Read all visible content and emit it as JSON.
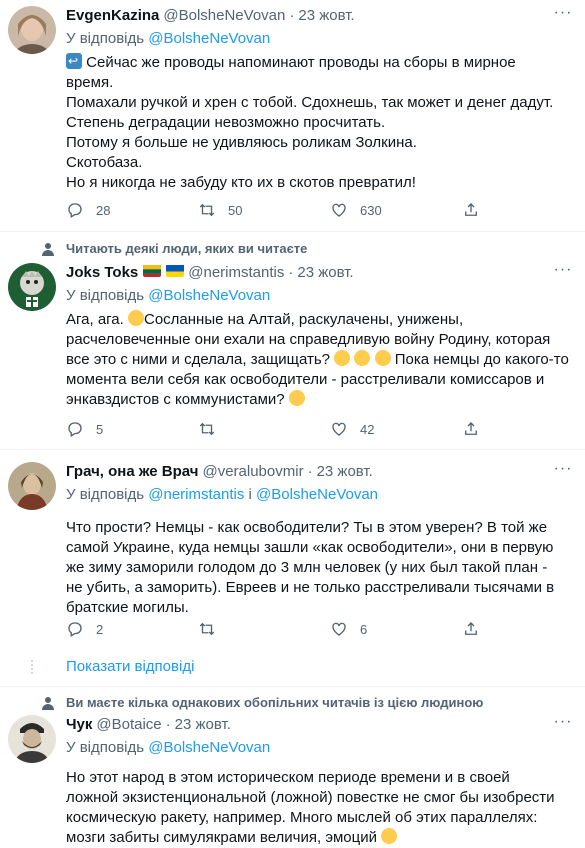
{
  "tweets": [
    {
      "author_name": "EvgenKazina",
      "handle": "@BolsheNeVovan",
      "date": "23 жовт.",
      "reply_prefix": "У відповідь",
      "reply_to": "@BolsheNeVovan",
      "text_lines": [
        "Сейчас же проводы напоминают проводы на сборы в мирное",
        "время.",
        "Помахали ручкой и хрен с тобой. Сдохнешь, так может и денег дадут.",
        "Степень деградации невозможно просчитать.",
        "Потому я больше не удивляюсь роликам Золкина.",
        "Скотобаза.",
        "Но я никогда не забуду кто их в скотов превратил!"
      ],
      "replies": "28",
      "retweets": "50",
      "likes": "630"
    },
    {
      "social_context": "Читають деякі люди, яких ви читаєте",
      "author_name": "Joks Toks",
      "handle": "@nerimstantis",
      "date": "23 жовт.",
      "reply_prefix": "У відповідь",
      "reply_to": "@BolsheNeVovan",
      "text_lines": [
        "Ага, ага. ",
        "Сосланные на Алтай, раскулачены, унижены,",
        "расчеловеченные они ехали на справедливую войну Родину, которая",
        "все это с ними и сделала, защищать? ",
        " Пока немцы до какого-то",
        "момента вели себя как освободители - расстреливали комиссаров и",
        "энкавздистов с коммунистами? "
      ],
      "replies": "5",
      "retweets": "",
      "likes": "42"
    },
    {
      "author_name": "Грач, она же Врач",
      "handle": "@veralubovmir",
      "date": "23 жовт.",
      "reply_prefix": "У відповідь",
      "reply_to": "@nerimstantis",
      "reply_and": "і",
      "reply_to_2": "@BolsheNeVovan",
      "text_lines": [
        "Что прости? Немцы - как освободители? Ты в этом уверен? В той же",
        "самой Украине, куда немцы зашли «как освободители», они в первую",
        "же зиму заморили голодом до 3 млн человек (у них был такой план -",
        "не убить, а заморить). Евреев и не только расстреливали тысячами в",
        "братские могилы."
      ],
      "replies": "2",
      "retweets": "",
      "likes": "6"
    },
    {
      "social_context": "Ви маєте кілька однакових обопільних читачів із цією людиною",
      "author_name": "Чук",
      "handle": "@Botaice",
      "date": "23 жовт.",
      "reply_prefix": "У відповідь",
      "reply_to": "@BolsheNeVovan",
      "text_lines": [
        "Но этот народ в этом историческом периоде времени и в своей",
        "ложной экзистенциональной (ложной) повестке не смог бы изобрести",
        "космическую ракету, например. Много мыслей об этих параллелях:",
        "мозги забиты симулякрами величия, эмоций "
      ]
    }
  ],
  "show_replies_label": "Показати відповіді",
  "more_glyph": "···",
  "colors": {
    "accent": "#1d9bf0",
    "muted": "#536471",
    "text": "#0f1419",
    "separator": "#eff3f4"
  },
  "icons": [
    "reply-icon",
    "retweet-icon",
    "like-icon",
    "share-icon",
    "more-icon",
    "person-icon"
  ]
}
